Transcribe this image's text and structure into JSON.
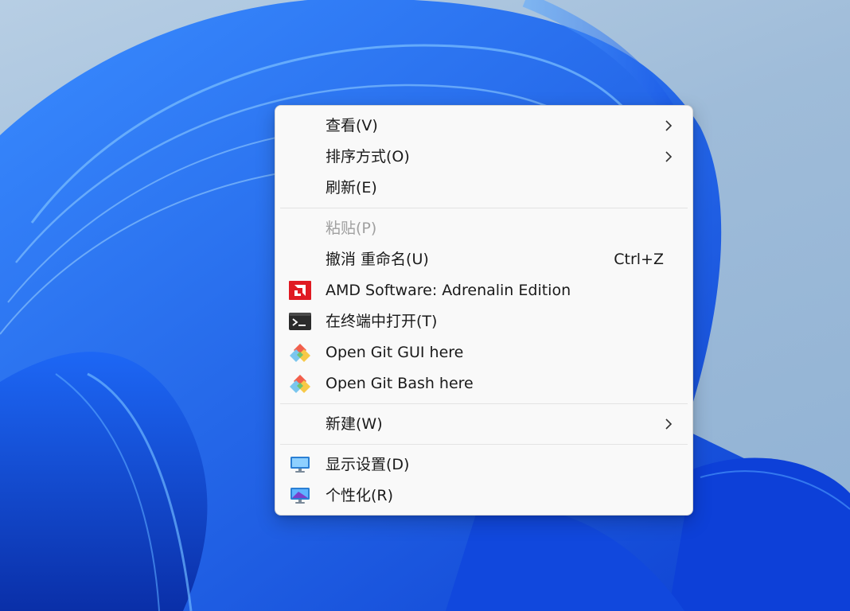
{
  "menu": {
    "items": [
      {
        "label": "查看(V)",
        "submenu": true,
        "icon": null
      },
      {
        "label": "排序方式(O)",
        "submenu": true,
        "icon": null
      },
      {
        "label": "刷新(E)",
        "submenu": false,
        "icon": null
      },
      {
        "label": "粘贴(P)",
        "submenu": false,
        "icon": null,
        "disabled": true
      },
      {
        "label": "撤消 重命名(U)",
        "submenu": false,
        "icon": null,
        "shortcut": "Ctrl+Z"
      },
      {
        "label": "AMD Software: Adrenalin Edition",
        "submenu": false,
        "icon": "amd-logo-icon"
      },
      {
        "label": "在终端中打开(T)",
        "submenu": false,
        "icon": "terminal-icon"
      },
      {
        "label": "Open Git GUI here",
        "submenu": false,
        "icon": "git-icon"
      },
      {
        "label": "Open Git Bash here",
        "submenu": false,
        "icon": "git-icon"
      },
      {
        "label": "新建(W)",
        "submenu": true,
        "icon": null
      },
      {
        "label": "显示设置(D)",
        "submenu": false,
        "icon": "display-settings-icon"
      },
      {
        "label": "个性化(R)",
        "submenu": false,
        "icon": "personalize-icon"
      }
    ]
  },
  "colors": {
    "menu_bg": "#f9f9f9",
    "amd_red": "#e01a22",
    "wallpaper_blue": "#1a5cf0"
  }
}
